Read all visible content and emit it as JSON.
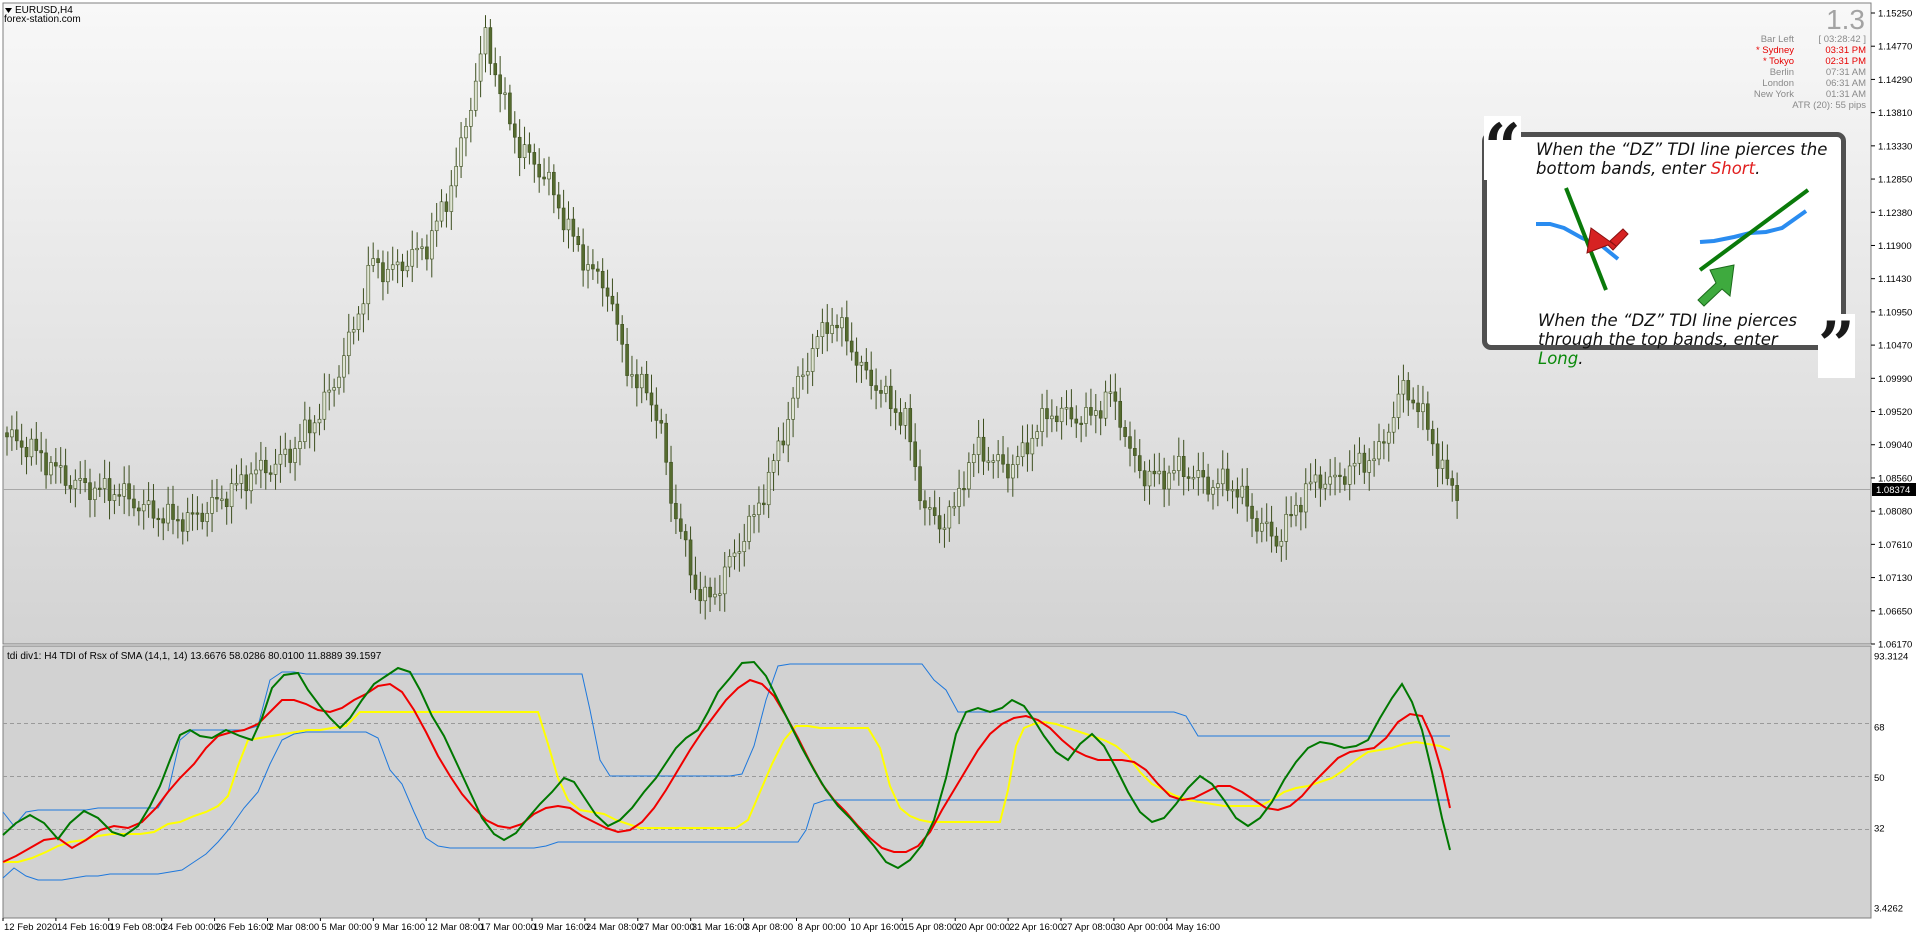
{
  "window": {
    "symbol": "EURUSD,H4",
    "watermark": "forex-station.com"
  },
  "price_axis": {
    "labels": [
      "1.15250",
      "1.14770",
      "1.14290",
      "1.13810",
      "1.13330",
      "1.12850",
      "1.12380",
      "1.11900",
      "1.11430",
      "1.10950",
      "1.10470",
      "1.09990",
      "1.09520",
      "1.09040",
      "1.08560",
      "1.08080",
      "1.07610",
      "1.07130",
      "1.06650",
      "1.06170"
    ],
    "current_price": "1.08374"
  },
  "info_panel": {
    "big_value": "1.3",
    "rows": [
      {
        "label": "Bar Left",
        "value": "[ 03:28:42 ]",
        "color": "#8a8a8a"
      },
      {
        "label": "* Sydney",
        "value": "03:31 PM",
        "color": "#e60000"
      },
      {
        "label": "* Tokyo",
        "value": "02:31 PM",
        "color": "#e60000"
      },
      {
        "label": "Berlin",
        "value": "07:31 AM",
        "color": "#8a8a8a"
      },
      {
        "label": "London",
        "value": "06:31 AM",
        "color": "#8a8a8a"
      },
      {
        "label": "New York",
        "value": "01:31 AM",
        "color": "#8a8a8a"
      }
    ],
    "atr": "ATR (20): 55 pips"
  },
  "callout": {
    "open_quote": "“",
    "close_quote": "”",
    "short_pre": "When the “DZ” TDI line pierces the bottom bands, enter ",
    "short_word": "Short",
    "long_pre": "When the “DZ” TDI line pierces through the top bands, enter ",
    "long_word": "Long",
    "period": "."
  },
  "indicator": {
    "title": "tdi div1: H4  TDI of Rsx of SMA (14,1, 14) 13.6676 58.0286 80.0100 11.8889 39.1597",
    "axis_labels": [
      "93.3124",
      "68",
      "50",
      "32",
      "3.4262"
    ],
    "level_values": [
      68,
      50,
      32
    ],
    "range": [
      3.4262,
      93.3124
    ]
  },
  "time_axis": {
    "labels": [
      "12 Feb 2020",
      "14 Feb 16:00",
      "19 Feb 08:00",
      "24 Feb 00:00",
      "26 Feb 16:00",
      "2 Mar 08:00",
      "5 Mar 00:00",
      "9 Mar 16:00",
      "12 Mar 08:00",
      "17 Mar 00:00",
      "19 Mar 16:00",
      "24 Mar 08:00",
      "27 Mar 00:00",
      "31 Mar 16:00",
      "3 Apr 08:00",
      "8 Apr 00:00",
      "10 Apr 16:00",
      "15 Apr 08:00",
      "20 Apr 00:00",
      "22 Apr 16:00",
      "27 Apr 08:00",
      "30 Apr 00:00",
      "4 May 16:00"
    ]
  },
  "colors": {
    "bull": "#dfe4d3",
    "bear": "#556b2f",
    "wick": "#3d4f1f",
    "green_line": "#007800",
    "red_line": "#f00000",
    "yellow_line": "#ffff00",
    "band_line": "#1e78dc",
    "callout_blue": "#2a8cf0",
    "callout_green": "#0a7a0a",
    "arrow_red": "#d62222",
    "arrow_green": "#3eaa3e"
  },
  "chart_data": {
    "type": "candlestick",
    "symbol": "EURUSD",
    "timeframe": "H4",
    "ylim": [
      1.0617,
      1.1525
    ],
    "current_price": 1.08374,
    "close_anchors": [
      [
        0,
        1.0915
      ],
      [
        5,
        1.0898
      ],
      [
        9,
        1.0874
      ],
      [
        13,
        1.085
      ],
      [
        18,
        1.084
      ],
      [
        23,
        1.0835
      ],
      [
        28,
        1.0812
      ],
      [
        32,
        1.08
      ],
      [
        37,
        1.0795
      ],
      [
        41,
        1.081
      ],
      [
        46,
        1.0838
      ],
      [
        50,
        1.0862
      ],
      [
        55,
        1.0875
      ],
      [
        59,
        1.09
      ],
      [
        64,
        1.095
      ],
      [
        67,
        1.0992
      ],
      [
        70,
        1.105
      ],
      [
        73,
        1.112
      ],
      [
        75,
        1.117
      ],
      [
        78,
        1.115
      ],
      [
        82,
        1.117
      ],
      [
        86,
        1.119
      ],
      [
        90,
        1.1255
      ],
      [
        93,
        1.133
      ],
      [
        96,
        1.143
      ],
      [
        98,
        1.149
      ],
      [
        100,
        1.144
      ],
      [
        102,
        1.139
      ],
      [
        105,
        1.133
      ],
      [
        108,
        1.131
      ],
      [
        111,
        1.128
      ],
      [
        114,
        1.123
      ],
      [
        117,
        1.1185
      ],
      [
        120,
        1.115
      ],
      [
        123,
        1.113
      ],
      [
        126,
        1.104
      ],
      [
        129,
        1.0985
      ],
      [
        131,
        1.099
      ],
      [
        134,
        1.092
      ],
      [
        136,
        1.083
      ],
      [
        139,
        1.075
      ],
      [
        141,
        1.07
      ],
      [
        143,
        1.068
      ],
      [
        145,
        1.069
      ],
      [
        147,
        1.072
      ],
      [
        150,
        1.076
      ],
      [
        153,
        1.08
      ],
      [
        156,
        1.0855
      ],
      [
        159,
        1.092
      ],
      [
        162,
        1.099
      ],
      [
        165,
        1.104
      ],
      [
        168,
        1.108
      ],
      [
        170,
        1.1075
      ],
      [
        172,
        1.106
      ],
      [
        175,
        1.101
      ],
      [
        178,
        1.099
      ],
      [
        181,
        1.096
      ],
      [
        184,
        1.094
      ],
      [
        186,
        1.087
      ],
      [
        188,
        1.081
      ],
      [
        191,
        1.079
      ],
      [
        194,
        1.081
      ],
      [
        196,
        1.086
      ],
      [
        199,
        1.09
      ],
      [
        202,
        1.088
      ],
      [
        205,
        1.087
      ],
      [
        208,
        1.089
      ],
      [
        211,
        1.093
      ],
      [
        214,
        1.095
      ],
      [
        218,
        1.0945
      ],
      [
        221,
        1.094
      ],
      [
        224,
        1.096
      ],
      [
        226,
        1.0975
      ],
      [
        228,
        1.0945
      ],
      [
        230,
        1.089
      ],
      [
        233,
        1.086
      ],
      [
        236,
        1.0855
      ],
      [
        240,
        1.087
      ],
      [
        243,
        1.086
      ],
      [
        246,
        1.0845
      ],
      [
        249,
        1.085
      ],
      [
        252,
        1.084
      ],
      [
        255,
        1.08
      ],
      [
        258,
        1.078
      ],
      [
        260,
        1.0765
      ],
      [
        263,
        1.08
      ],
      [
        266,
        1.084
      ],
      [
        269,
        1.0855
      ],
      [
        272,
        1.085
      ],
      [
        275,
        1.087
      ],
      [
        278,
        1.088
      ],
      [
        281,
        1.089
      ],
      [
        284,
        1.095
      ],
      [
        286,
        1.0985
      ],
      [
        288,
        1.097
      ],
      [
        291,
        1.093
      ],
      [
        293,
        1.0885
      ],
      [
        295,
        1.085
      ],
      [
        297,
        1.0838
      ]
    ]
  }
}
